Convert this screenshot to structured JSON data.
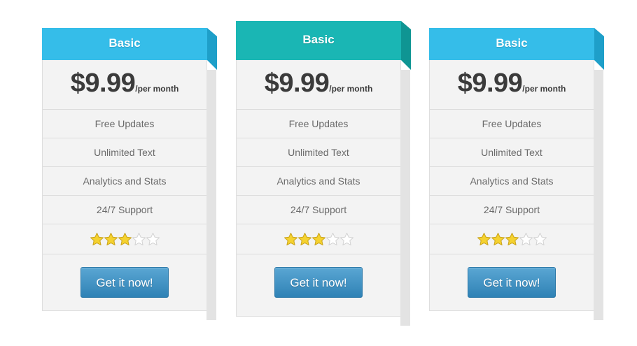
{
  "plans": [
    {
      "title": "Basic",
      "price": "$9.99",
      "period": "/per month",
      "features": [
        "Free Updates",
        "Unlimited Text",
        "Analytics and Stats",
        "24/7 Support"
      ],
      "rating": 3,
      "rating_max": 5,
      "cta_label": "Get it now!",
      "header_color": "#35bde9",
      "fold_color": "#1e9fc9"
    },
    {
      "title": "Basic",
      "price": "$9.99",
      "period": "/per month",
      "features": [
        "Free Updates",
        "Unlimited Text",
        "Analytics and Stats",
        "24/7 Support"
      ],
      "rating": 3,
      "rating_max": 5,
      "cta_label": "Get it now!",
      "header_color": "#1ab6b4",
      "fold_color": "#0f9593",
      "featured": true
    },
    {
      "title": "Basic",
      "price": "$9.99",
      "period": "/per month",
      "features": [
        "Free Updates",
        "Unlimited Text",
        "Analytics and Stats",
        "24/7 Support"
      ],
      "rating": 3,
      "rating_max": 5,
      "cta_label": "Get it now!",
      "header_color": "#35bde9",
      "fold_color": "#1e9fc9"
    }
  ],
  "colors": {
    "star_filled": "#f5d230",
    "star_empty": "#ffffff",
    "cta_button": "#3f8fc1"
  }
}
